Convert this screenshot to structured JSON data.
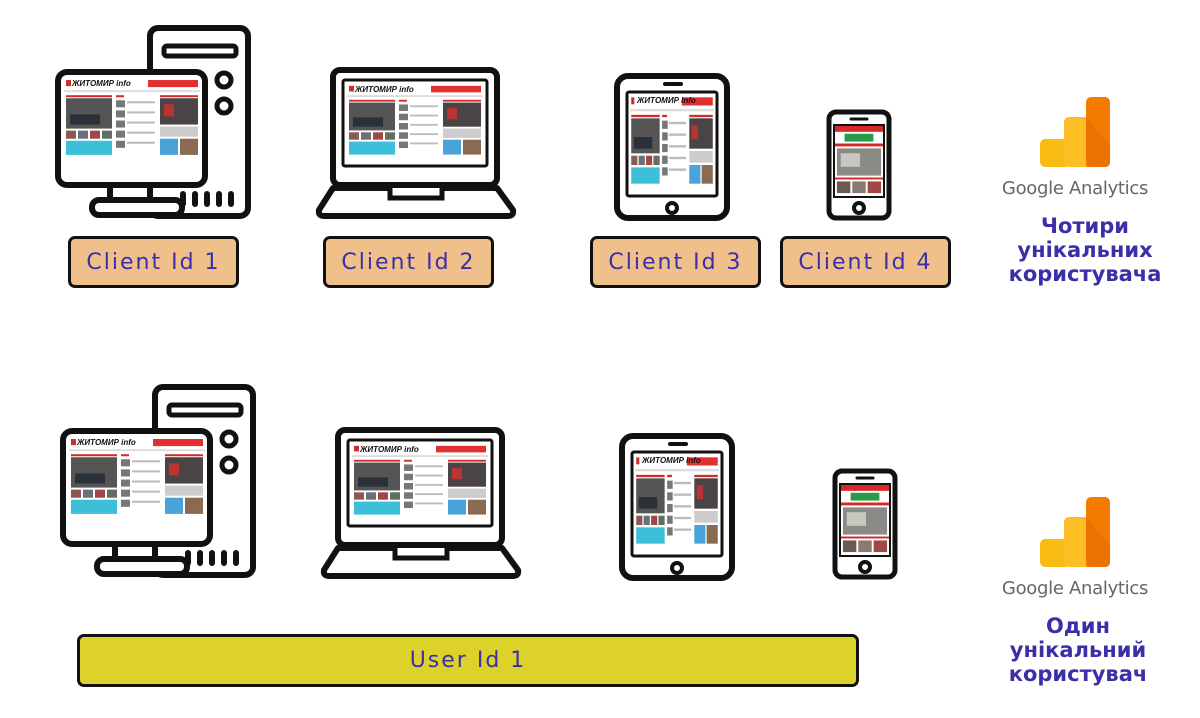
{
  "site_logo": "ЖИТОМИР info",
  "colors": {
    "client_box": "#f0c08a",
    "user_bar": "#ddd22a",
    "label_text": "#3a2fa8",
    "ga_yellow": "#f9bc15",
    "ga_orange": "#f47b00"
  },
  "top_row": {
    "devices": [
      "desktop-icon",
      "laptop-icon",
      "tablet-icon",
      "phone-icon"
    ],
    "labels": [
      "Client Id 1",
      "Client Id 2",
      "Client Id 3",
      "Client Id 4"
    ],
    "analytics": {
      "name": "Google Analytics",
      "caption": [
        "Чотири",
        "унікальних",
        "користувача"
      ]
    }
  },
  "bottom_row": {
    "devices": [
      "desktop-icon",
      "laptop-icon",
      "tablet-icon",
      "phone-icon"
    ],
    "label": "User Id 1",
    "analytics": {
      "name": "Google Analytics",
      "caption": [
        "Один",
        "унікальний",
        "користувач"
      ]
    }
  }
}
